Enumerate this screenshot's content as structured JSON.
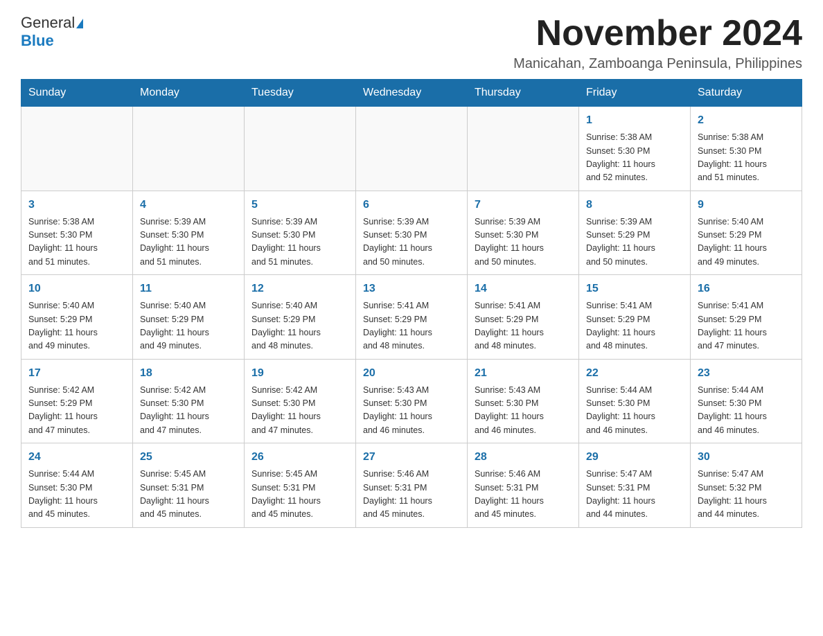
{
  "header": {
    "logo_general": "General",
    "logo_blue": "Blue",
    "month_title": "November 2024",
    "location": "Manicahan, Zamboanga Peninsula, Philippines"
  },
  "weekdays": [
    "Sunday",
    "Monday",
    "Tuesday",
    "Wednesday",
    "Thursday",
    "Friday",
    "Saturday"
  ],
  "weeks": [
    [
      {
        "day": "",
        "info": ""
      },
      {
        "day": "",
        "info": ""
      },
      {
        "day": "",
        "info": ""
      },
      {
        "day": "",
        "info": ""
      },
      {
        "day": "",
        "info": ""
      },
      {
        "day": "1",
        "info": "Sunrise: 5:38 AM\nSunset: 5:30 PM\nDaylight: 11 hours\nand 52 minutes."
      },
      {
        "day": "2",
        "info": "Sunrise: 5:38 AM\nSunset: 5:30 PM\nDaylight: 11 hours\nand 51 minutes."
      }
    ],
    [
      {
        "day": "3",
        "info": "Sunrise: 5:38 AM\nSunset: 5:30 PM\nDaylight: 11 hours\nand 51 minutes."
      },
      {
        "day": "4",
        "info": "Sunrise: 5:39 AM\nSunset: 5:30 PM\nDaylight: 11 hours\nand 51 minutes."
      },
      {
        "day": "5",
        "info": "Sunrise: 5:39 AM\nSunset: 5:30 PM\nDaylight: 11 hours\nand 51 minutes."
      },
      {
        "day": "6",
        "info": "Sunrise: 5:39 AM\nSunset: 5:30 PM\nDaylight: 11 hours\nand 50 minutes."
      },
      {
        "day": "7",
        "info": "Sunrise: 5:39 AM\nSunset: 5:30 PM\nDaylight: 11 hours\nand 50 minutes."
      },
      {
        "day": "8",
        "info": "Sunrise: 5:39 AM\nSunset: 5:29 PM\nDaylight: 11 hours\nand 50 minutes."
      },
      {
        "day": "9",
        "info": "Sunrise: 5:40 AM\nSunset: 5:29 PM\nDaylight: 11 hours\nand 49 minutes."
      }
    ],
    [
      {
        "day": "10",
        "info": "Sunrise: 5:40 AM\nSunset: 5:29 PM\nDaylight: 11 hours\nand 49 minutes."
      },
      {
        "day": "11",
        "info": "Sunrise: 5:40 AM\nSunset: 5:29 PM\nDaylight: 11 hours\nand 49 minutes."
      },
      {
        "day": "12",
        "info": "Sunrise: 5:40 AM\nSunset: 5:29 PM\nDaylight: 11 hours\nand 48 minutes."
      },
      {
        "day": "13",
        "info": "Sunrise: 5:41 AM\nSunset: 5:29 PM\nDaylight: 11 hours\nand 48 minutes."
      },
      {
        "day": "14",
        "info": "Sunrise: 5:41 AM\nSunset: 5:29 PM\nDaylight: 11 hours\nand 48 minutes."
      },
      {
        "day": "15",
        "info": "Sunrise: 5:41 AM\nSunset: 5:29 PM\nDaylight: 11 hours\nand 48 minutes."
      },
      {
        "day": "16",
        "info": "Sunrise: 5:41 AM\nSunset: 5:29 PM\nDaylight: 11 hours\nand 47 minutes."
      }
    ],
    [
      {
        "day": "17",
        "info": "Sunrise: 5:42 AM\nSunset: 5:29 PM\nDaylight: 11 hours\nand 47 minutes."
      },
      {
        "day": "18",
        "info": "Sunrise: 5:42 AM\nSunset: 5:30 PM\nDaylight: 11 hours\nand 47 minutes."
      },
      {
        "day": "19",
        "info": "Sunrise: 5:42 AM\nSunset: 5:30 PM\nDaylight: 11 hours\nand 47 minutes."
      },
      {
        "day": "20",
        "info": "Sunrise: 5:43 AM\nSunset: 5:30 PM\nDaylight: 11 hours\nand 46 minutes."
      },
      {
        "day": "21",
        "info": "Sunrise: 5:43 AM\nSunset: 5:30 PM\nDaylight: 11 hours\nand 46 minutes."
      },
      {
        "day": "22",
        "info": "Sunrise: 5:44 AM\nSunset: 5:30 PM\nDaylight: 11 hours\nand 46 minutes."
      },
      {
        "day": "23",
        "info": "Sunrise: 5:44 AM\nSunset: 5:30 PM\nDaylight: 11 hours\nand 46 minutes."
      }
    ],
    [
      {
        "day": "24",
        "info": "Sunrise: 5:44 AM\nSunset: 5:30 PM\nDaylight: 11 hours\nand 45 minutes."
      },
      {
        "day": "25",
        "info": "Sunrise: 5:45 AM\nSunset: 5:31 PM\nDaylight: 11 hours\nand 45 minutes."
      },
      {
        "day": "26",
        "info": "Sunrise: 5:45 AM\nSunset: 5:31 PM\nDaylight: 11 hours\nand 45 minutes."
      },
      {
        "day": "27",
        "info": "Sunrise: 5:46 AM\nSunset: 5:31 PM\nDaylight: 11 hours\nand 45 minutes."
      },
      {
        "day": "28",
        "info": "Sunrise: 5:46 AM\nSunset: 5:31 PM\nDaylight: 11 hours\nand 45 minutes."
      },
      {
        "day": "29",
        "info": "Sunrise: 5:47 AM\nSunset: 5:31 PM\nDaylight: 11 hours\nand 44 minutes."
      },
      {
        "day": "30",
        "info": "Sunrise: 5:47 AM\nSunset: 5:32 PM\nDaylight: 11 hours\nand 44 minutes."
      }
    ]
  ]
}
